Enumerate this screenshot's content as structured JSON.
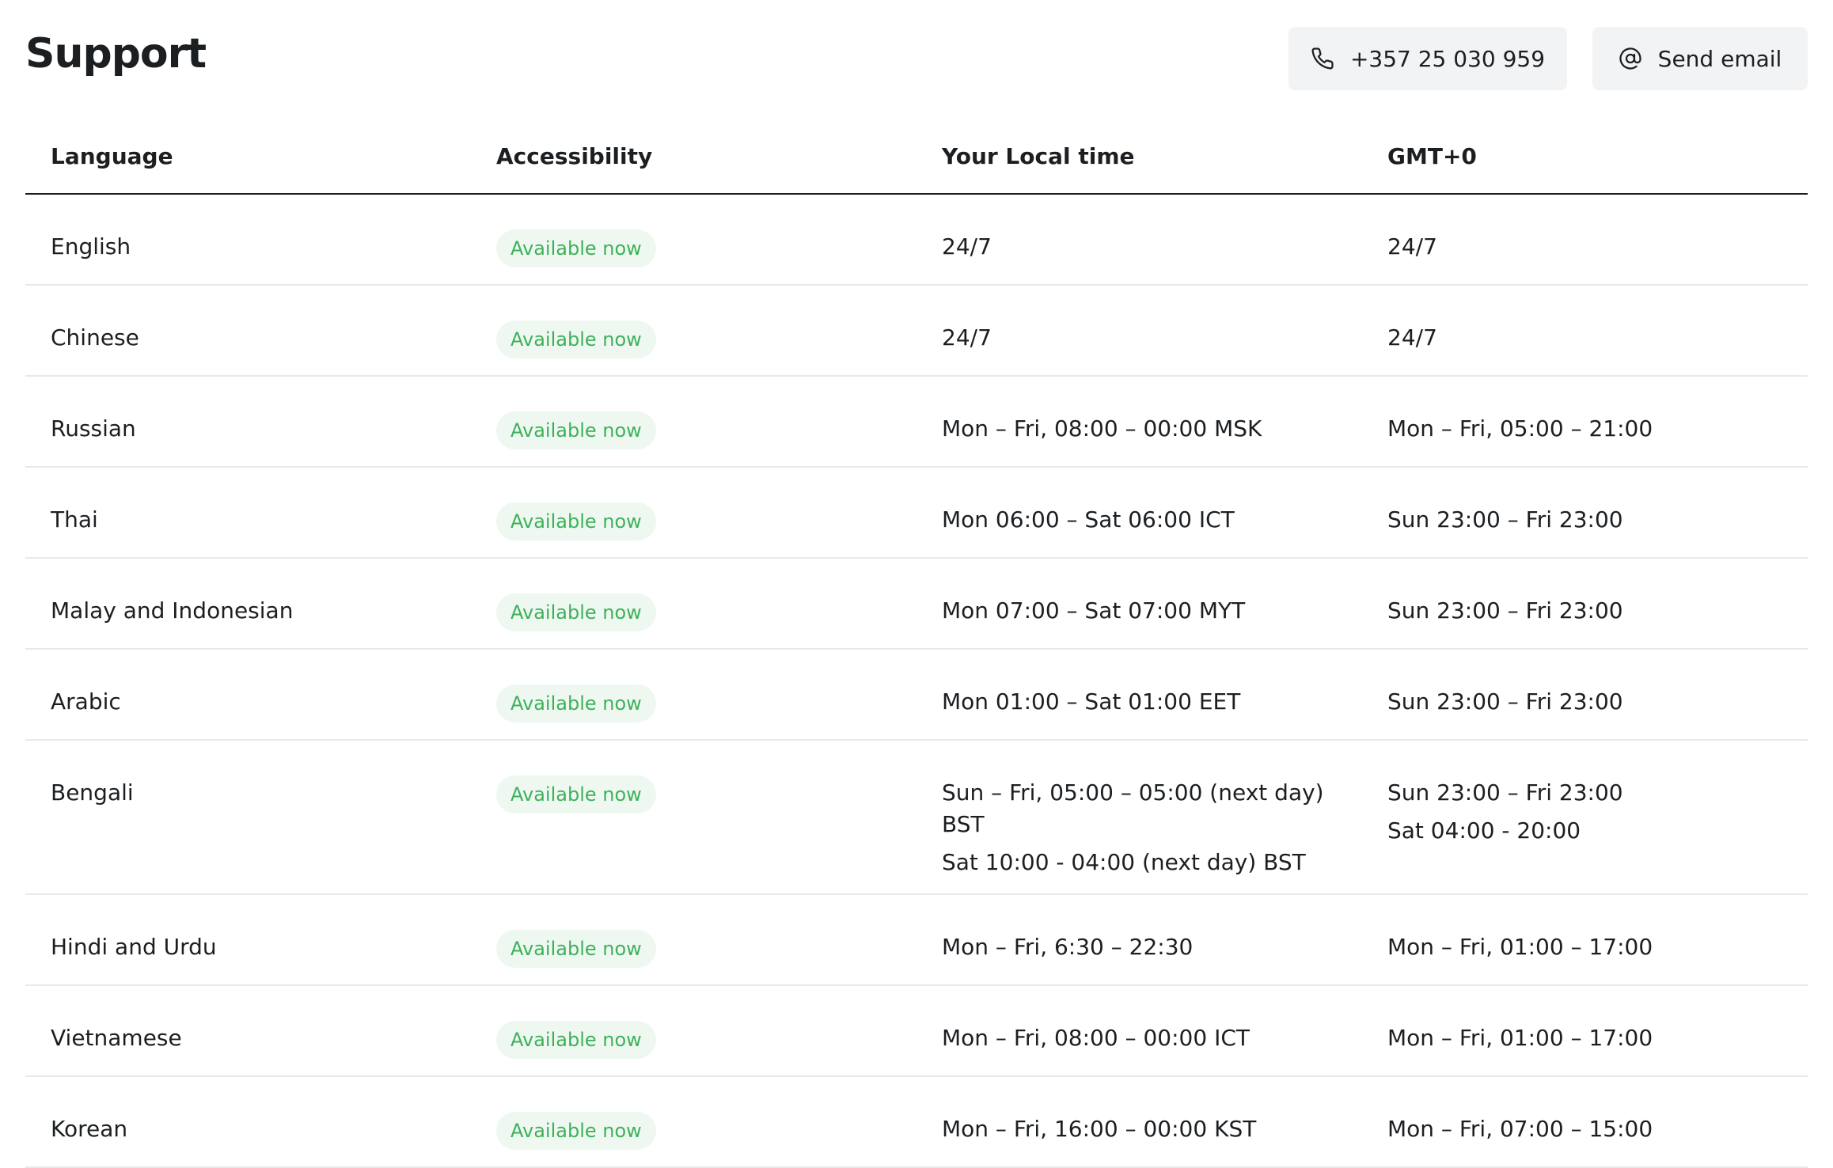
{
  "header": {
    "title": "Support",
    "phone_label": "+357 25 030 959",
    "email_label": "Send email"
  },
  "table": {
    "columns": [
      "Language",
      "Accessibility",
      "Your Local time",
      "GMT+0"
    ],
    "rows": [
      {
        "language": "English",
        "status": "Available now",
        "local": [
          "24/7"
        ],
        "gmt": [
          "24/7"
        ]
      },
      {
        "language": "Chinese",
        "status": "Available now",
        "local": [
          "24/7"
        ],
        "gmt": [
          "24/7"
        ]
      },
      {
        "language": "Russian",
        "status": "Available now",
        "local": [
          "Mon – Fri, 08:00 – 00:00 MSK"
        ],
        "gmt": [
          "Mon – Fri, 05:00 – 21:00"
        ]
      },
      {
        "language": "Thai",
        "status": "Available now",
        "local": [
          "Mon 06:00 – Sat 06:00 ICT"
        ],
        "gmt": [
          "Sun 23:00 – Fri 23:00"
        ]
      },
      {
        "language": "Malay and Indonesian",
        "status": "Available now",
        "local": [
          "Mon 07:00 – Sat 07:00 MYT"
        ],
        "gmt": [
          "Sun 23:00 – Fri 23:00"
        ]
      },
      {
        "language": "Arabic",
        "status": "Available now",
        "local": [
          "Mon 01:00 – Sat 01:00 EET"
        ],
        "gmt": [
          "Sun 23:00 – Fri 23:00"
        ]
      },
      {
        "language": "Bengali",
        "status": "Available now",
        "local": [
          "Sun – Fri, 05:00 – 05:00 (next day) BST",
          "Sat 10:00 - 04:00 (next day) BST"
        ],
        "gmt": [
          "Sun 23:00 – Fri 23:00",
          "Sat 04:00 - 20:00"
        ]
      },
      {
        "language": "Hindi and Urdu",
        "status": "Available now",
        "local": [
          "Mon – Fri, 6:30 – 22:30"
        ],
        "gmt": [
          "Mon – Fri, 01:00 – 17:00"
        ]
      },
      {
        "language": "Vietnamese",
        "status": "Available now",
        "local": [
          "Mon – Fri, 08:00 – 00:00 ICT"
        ],
        "gmt": [
          "Mon – Fri, 01:00 – 17:00"
        ]
      },
      {
        "language": "Korean",
        "status": "Available now",
        "local": [
          "Mon – Fri, 16:00 – 00:00 KST"
        ],
        "gmt": [
          "Mon – Fri, 07:00 – 15:00"
        ]
      }
    ]
  },
  "icons": {
    "phone": "phone-icon",
    "email": "at-sign-icon"
  },
  "colors": {
    "status_text": "#3db15a",
    "status_bg": "#eef8f0",
    "button_bg": "#f2f3f5",
    "divider": "#e7e9ec"
  }
}
